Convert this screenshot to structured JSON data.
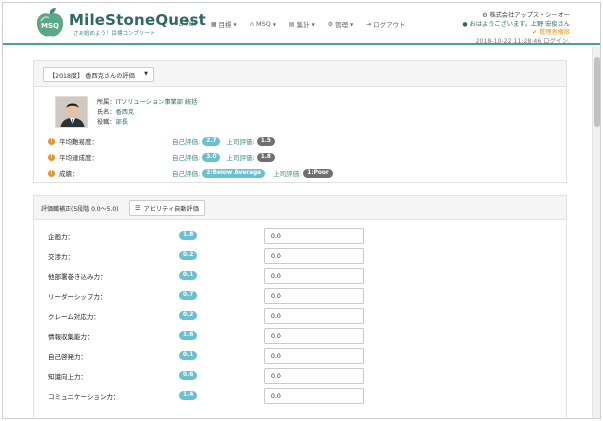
{
  "brand": {
    "title": "MileStoneQuest",
    "subtitle": "さぁ始めよう！目標コンプリート",
    "logo_text": "MSQ"
  },
  "nav": [
    {
      "icon": "home-icon",
      "label": "TOP",
      "has_caret": false
    },
    {
      "icon": "calendar-icon",
      "label": "目標",
      "has_caret": true
    },
    {
      "icon": "headphones-icon",
      "label": "MSQ",
      "has_caret": true
    },
    {
      "icon": "table-icon",
      "label": "集計",
      "has_caret": true
    },
    {
      "icon": "gear-icon",
      "label": "管理",
      "has_caret": true
    },
    {
      "icon": "logout-icon",
      "label": "ログアウト",
      "has_caret": false
    }
  ],
  "user": {
    "company": "株式会社アップス・シーオー",
    "greeting": "おはようございます。上野 宏俊さん",
    "admin_label": "管理者権限",
    "last_login": "2018-10-22 11:28:46 ログイン."
  },
  "evaluation": {
    "select_value": "【2018度】 香西克さんの評価",
    "profile": [
      {
        "key": "所属：",
        "value": "ITソリューション事業部 統括"
      },
      {
        "key": "氏名：",
        "value": "香西克"
      },
      {
        "key": "役職：",
        "value": "部長"
      }
    ],
    "metrics": [
      {
        "label": "平均難易度：",
        "self_label": "自己評価:",
        "self_value": "2.7",
        "boss_label": "上司評価:",
        "boss_value": "1.5"
      },
      {
        "label": "平均達成度：",
        "self_label": "自己評価:",
        "self_value": "3.0",
        "boss_label": "上司評価:",
        "boss_value": "1.8"
      },
      {
        "label": "成績：",
        "self_label": "自己評価:",
        "self_value": "2:Below Average",
        "boss_label": "上司評価:",
        "boss_value": "1:Poor"
      }
    ]
  },
  "skills": {
    "title": "評価職補正(5段階 0.0～5.0)",
    "ability_button": "アビリティ自動評価",
    "rows": [
      {
        "name": "企画力：",
        "badge": "1.8",
        "input": "0.0"
      },
      {
        "name": "交渉力：",
        "badge": "0.2",
        "input": "0.0"
      },
      {
        "name": "他部署巻き込み力：",
        "badge": "0.1",
        "input": "0.0"
      },
      {
        "name": "リーダーシップ力：",
        "badge": "0.7",
        "input": "0.0"
      },
      {
        "name": "クレーム対応力：",
        "badge": "0.2",
        "input": "0.0"
      },
      {
        "name": "情報収集能力：",
        "badge": "1.6",
        "input": "0.0"
      },
      {
        "name": "自己啓発力：",
        "badge": "0.1",
        "input": "0.0"
      },
      {
        "name": "知識向上力：",
        "badge": "0.6",
        "input": "0.0"
      },
      {
        "name": "コミュニケーション力：",
        "badge": "1.4",
        "input": "0.0"
      }
    ]
  },
  "colors": {
    "accent": "#4aa391",
    "brand": "#2d6a60",
    "badge_teal": "#69c0cf",
    "badge_gray": "#6f6f6f",
    "warning": "#e8932a"
  }
}
